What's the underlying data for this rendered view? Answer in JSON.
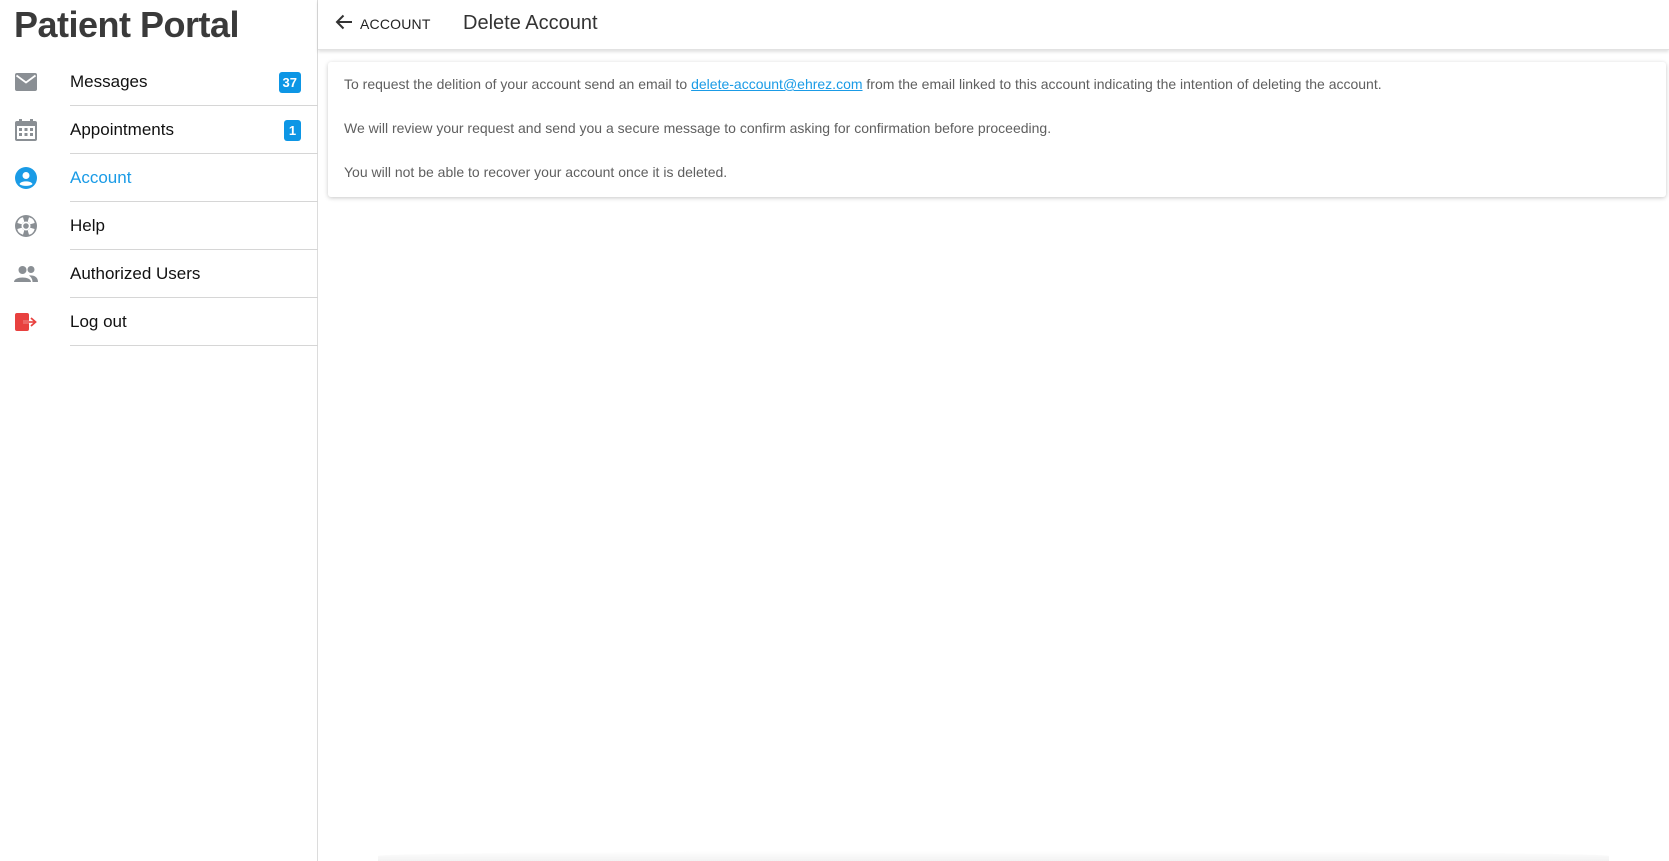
{
  "app": {
    "title": "Patient Portal"
  },
  "sidebar": {
    "items": [
      {
        "label": "Messages",
        "icon": "mail-icon",
        "badge": "37"
      },
      {
        "label": "Appointments",
        "icon": "calendar-icon",
        "badge": "1"
      },
      {
        "label": "Account",
        "icon": "account-circle-icon",
        "active": true
      },
      {
        "label": "Help",
        "icon": "lifebuoy-icon"
      },
      {
        "label": "Authorized Users",
        "icon": "users-icon"
      },
      {
        "label": "Log out",
        "icon": "logout-icon"
      }
    ]
  },
  "header": {
    "back_label": "ACCOUNT",
    "title": "Delete Account"
  },
  "content": {
    "para1_before": "To request the delition of your account send an email to ",
    "email": "delete-account@ehrez.com",
    "para1_after": " from the email linked to this account indicating the intention of deleting the account.",
    "para2": "We will review your request and send you a secure message to confirm asking for confirmation before proceeding.",
    "para3": "You will not be able to recover your account once it is deleted."
  },
  "colors": {
    "accent": "#1a9be6",
    "badge": "#0d96e5",
    "logout": "#e8413f",
    "icon_gray": "#8a8f94"
  }
}
